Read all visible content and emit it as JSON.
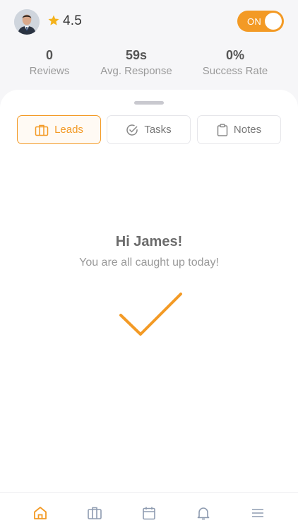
{
  "profile": {
    "avatar_icon": "user-avatar",
    "rating": "4.5",
    "star_icon": "star-icon",
    "star_color": "#f4b21b"
  },
  "availability": {
    "label": "ON",
    "state": true,
    "color": "#f39a25"
  },
  "stats": [
    {
      "value": "0",
      "label": "Reviews"
    },
    {
      "value": "59s",
      "label": "Avg. Response"
    },
    {
      "value": "0%",
      "label": "Success Rate"
    }
  ],
  "tabs": [
    {
      "label": "Leads",
      "icon": "briefcase-icon",
      "active": true
    },
    {
      "label": "Tasks",
      "icon": "check-circle-icon",
      "active": false
    },
    {
      "label": "Notes",
      "icon": "clipboard-icon",
      "active": false
    }
  ],
  "empty_state": {
    "title": "Hi James!",
    "subtitle": "You are all caught up today!",
    "icon": "checkmark-icon"
  },
  "bottom_nav": [
    {
      "icon": "home-icon",
      "active": true
    },
    {
      "icon": "briefcase-icon",
      "active": false
    },
    {
      "icon": "calendar-icon",
      "active": false
    },
    {
      "icon": "bell-icon",
      "active": false
    },
    {
      "icon": "menu-icon",
      "active": false
    }
  ],
  "colors": {
    "accent": "#f39a25",
    "muted": "#8e9bb0"
  }
}
